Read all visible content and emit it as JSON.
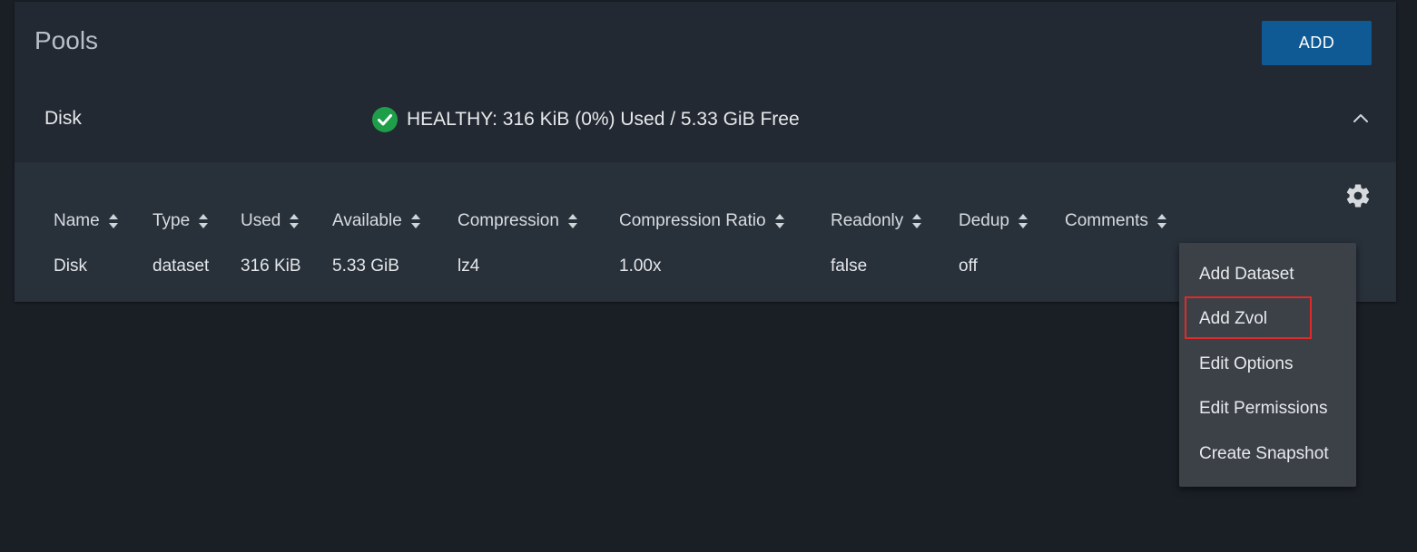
{
  "page": {
    "title": "Pools",
    "add_label": "ADD"
  },
  "pool": {
    "name": "Disk",
    "status_text": "HEALTHY: 316 KiB (0%) Used / 5.33 GiB Free",
    "status_icon": "check-circle-icon",
    "status_color": "#1f9e4a",
    "expanded": true
  },
  "table": {
    "columns": [
      "Name",
      "Type",
      "Used",
      "Available",
      "Compression",
      "Compression Ratio",
      "Readonly",
      "Dedup",
      "Comments"
    ],
    "rows": [
      {
        "name": "Disk",
        "type": "dataset",
        "used": "316 KiB",
        "available": "5.33 GiB",
        "compression": "lz4",
        "compression_ratio": "1.00x",
        "readonly": "false",
        "dedup": "off",
        "comments": ""
      }
    ]
  },
  "menu": {
    "items": [
      "Add Dataset",
      "Add Zvol",
      "Edit Options",
      "Edit Permissions",
      "Create Snapshot"
    ],
    "highlighted": "Add Zvol"
  },
  "colors": {
    "accent": "#0f5a94",
    "highlight": "#e02a2a"
  }
}
